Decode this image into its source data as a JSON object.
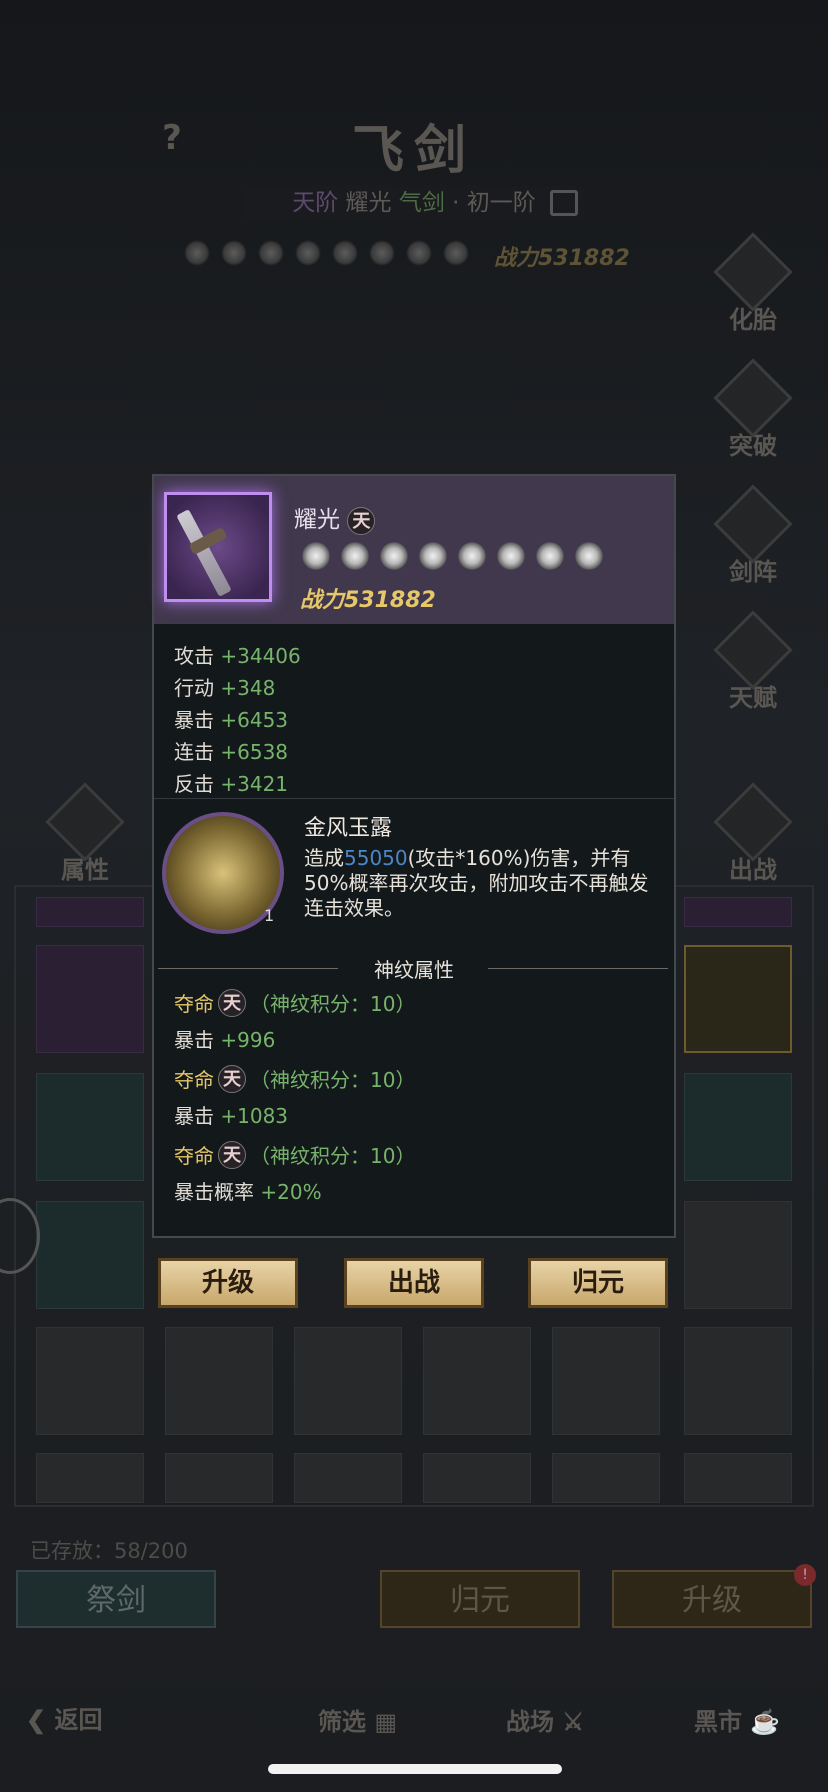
{
  "background": {
    "page_title": "飞剑",
    "help_icon": "?",
    "title_sub": {
      "rank": "天阶",
      "name": "耀光",
      "kind": "气剑",
      "dot": "·",
      "stage": "初一阶"
    },
    "power": "战力531882",
    "side_buttons": [
      "化胎",
      "突破",
      "剑阵",
      "天赋"
    ],
    "attr_label": "属性",
    "deploy_label": "出战",
    "storage": "已存放：58/200",
    "bottom_buttons": {
      "sacrifice": "祭剑",
      "reset": "归元",
      "upgrade": "升级"
    },
    "badge": "!",
    "nav": {
      "back": "返回",
      "filter": "筛选",
      "arena": "战场",
      "black_market": "黑市"
    }
  },
  "popup": {
    "item_name": "耀光",
    "rarity_glyph": "天",
    "power": "战力531882",
    "stars": 8,
    "stats": [
      {
        "label": "攻击",
        "value": "+34406"
      },
      {
        "label": "行动",
        "value": "+348"
      },
      {
        "label": "暴击",
        "value": "+6453"
      },
      {
        "label": "连击",
        "value": "+6538"
      },
      {
        "label": "反击",
        "value": "+3421"
      }
    ],
    "skill": {
      "name": "金风玉露",
      "level": "1",
      "desc_pre": "造成",
      "desc_num": "55050",
      "desc_post": "(攻击*160%)伤害，并有50%概率再次攻击，附加攻击不再触发连击效果。"
    },
    "rune_title": "神纹属性",
    "runes": [
      {
        "name": "夺命",
        "score": "（神纹积分：10）",
        "stat": "暴击",
        "value": "+996"
      },
      {
        "name": "夺命",
        "score": "（神纹积分：10）",
        "stat": "暴击",
        "value": "+1083"
      },
      {
        "name": "夺命",
        "score": "（神纹积分：10）",
        "stat": "暴击概率",
        "value": "+20%"
      }
    ],
    "actions": {
      "upgrade": "升级",
      "deploy": "出战",
      "reset": "归元"
    }
  },
  "colors": {
    "accent_gold": "#e6c86a",
    "stat_green": "#77b46b",
    "rare_purple": "#c08ef0",
    "damage_blue": "#4a86c8"
  },
  "icons": [
    "help-icon",
    "lock-icon",
    "star-icon",
    "rarity-icon",
    "back-icon",
    "filter-icon",
    "arena-icon",
    "shop-icon"
  ]
}
